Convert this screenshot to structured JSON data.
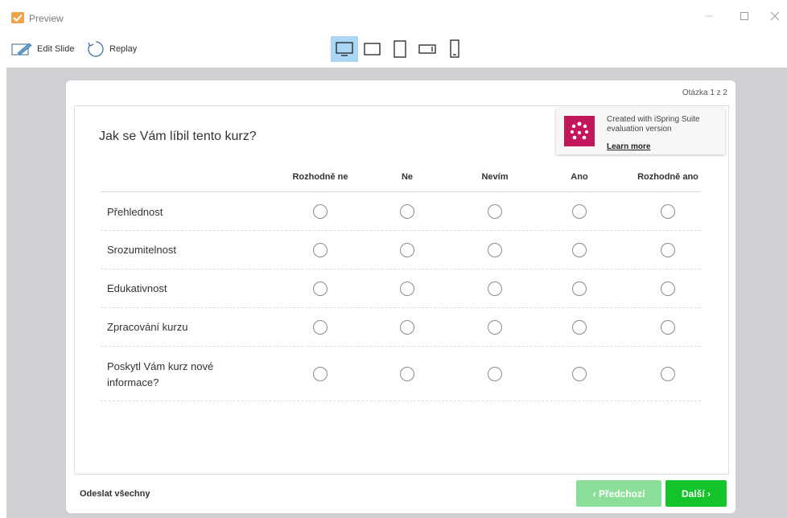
{
  "window": {
    "title": "Preview"
  },
  "toolbar": {
    "edit_slide_label": "Edit Slide",
    "replay_label": "Replay",
    "devices": [
      "monitor-icon",
      "tablet-landscape-icon",
      "tablet-portrait-icon",
      "phone-landscape-icon",
      "phone-portrait-icon"
    ],
    "active_device": "monitor-icon"
  },
  "slide": {
    "counter": "Otázka 1 z 2",
    "question": "Jak se Vám líbil tento kurz?",
    "badge": {
      "line1": "Created with iSpring Suite",
      "line2": "evaluation version",
      "link": "Learn more"
    },
    "columns": [
      "Rozhodně ne",
      "Ne",
      "Nevím",
      "Ano",
      "Rozhodně ano"
    ],
    "rows": [
      {
        "label": "Přehlednost"
      },
      {
        "label": "Srozumitelnost"
      },
      {
        "label": "Edukativnost"
      },
      {
        "label": "Zpracování kurzu"
      },
      {
        "label_line1": "Poskytl Vám kurz nové",
        "label_line2": "informace?"
      }
    ],
    "footer": {
      "submit_all": "Odeslat všechny",
      "prev": "‹ Předchozí",
      "next": "Další ›"
    }
  },
  "colors": {
    "accent_green": "#13c52b",
    "prev_disabled": "#8bdf9b",
    "active_device": "#a9d6f5",
    "badge_logo": "#c2185b"
  }
}
